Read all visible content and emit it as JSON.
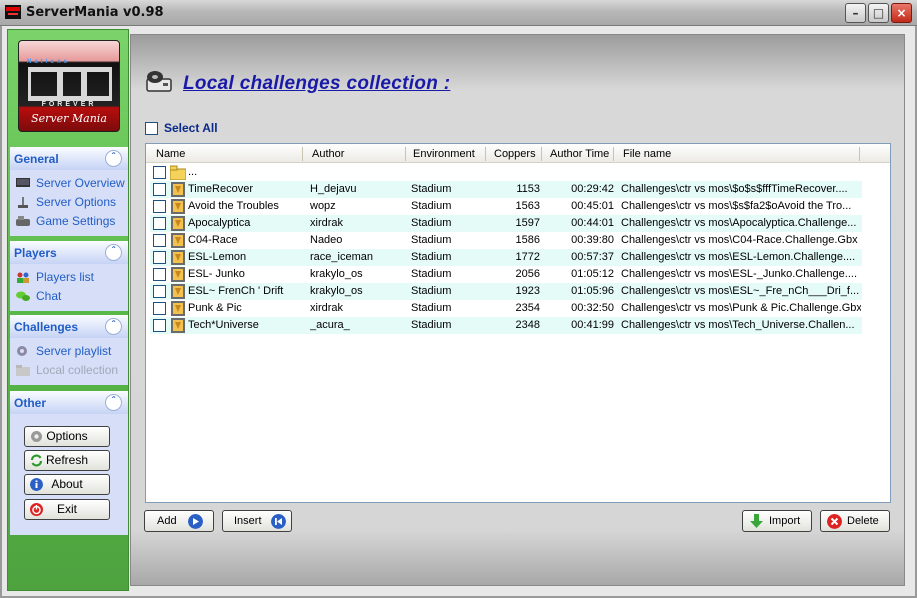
{
  "window": {
    "title": "ServerMania v0.98"
  },
  "logo": {
    "top_text": "Nations",
    "middle_text": "FOREVER",
    "bottom_text": "Server Mania"
  },
  "sidebar": {
    "groups": [
      {
        "title": "General",
        "items": [
          {
            "label": "Server Overview",
            "icon": "monitor-icon"
          },
          {
            "label": "Server Options",
            "icon": "joystick-icon"
          },
          {
            "label": "Game Settings",
            "icon": "gamepad-icon"
          }
        ]
      },
      {
        "title": "Players",
        "items": [
          {
            "label": "Players list",
            "icon": "users-icon"
          },
          {
            "label": "Chat",
            "icon": "chat-icon"
          }
        ]
      },
      {
        "title": "Challenges",
        "items": [
          {
            "label": "Server playlist",
            "icon": "playlist-icon"
          },
          {
            "label": "Local collection",
            "icon": "folder-icon",
            "disabled": true
          }
        ]
      },
      {
        "title": "Other",
        "items": []
      }
    ],
    "buttons": {
      "options": "Options",
      "refresh": "Refresh",
      "about": "About",
      "exit": "Exit"
    }
  },
  "main": {
    "heading": "Local challenges collection :",
    "select_all": "Select All",
    "columns": [
      "Name",
      "Author",
      "Environment",
      "Coppers",
      "Author Time",
      "File name"
    ],
    "parent_row": "...",
    "rows": [
      {
        "name": "TimeRecover",
        "author": "H_dejavu",
        "env": "Stadium",
        "coppers": "1153",
        "time": "00:29:42",
        "file": "Challenges\\ctr vs mos\\$o$s$fffTimeRecover...."
      },
      {
        "name": "Avoid the Troubles",
        "author": "wopz",
        "env": "Stadium",
        "coppers": "1563",
        "time": "00:45:01",
        "file": "Challenges\\ctr vs mos\\$s$fa2$oAvoid the Tro..."
      },
      {
        "name": "Apocalyptica",
        "author": "xirdrak",
        "env": "Stadium",
        "coppers": "1597",
        "time": "00:44:01",
        "file": "Challenges\\ctr vs mos\\Apocalyptica.Challenge..."
      },
      {
        "name": "C04-Race",
        "author": "Nadeo",
        "env": "Stadium",
        "coppers": "1586",
        "time": "00:39:80",
        "file": "Challenges\\ctr vs mos\\C04-Race.Challenge.Gbx"
      },
      {
        "name": "ESL-Lemon",
        "author": "race_iceman",
        "env": "Stadium",
        "coppers": "1772",
        "time": "00:57:37",
        "file": "Challenges\\ctr vs mos\\ESL-Lemon.Challenge...."
      },
      {
        "name": "ESL- Junko",
        "author": "krakylo_os",
        "env": "Stadium",
        "coppers": "2056",
        "time": "01:05:12",
        "file": "Challenges\\ctr vs mos\\ESL-_Junko.Challenge...."
      },
      {
        "name": "ESL~ FrenCh ' Drift",
        "author": "krakylo_os",
        "env": "Stadium",
        "coppers": "1923",
        "time": "01:05:96",
        "file": "Challenges\\ctr vs mos\\ESL~_Fre_nCh___Dri_f..."
      },
      {
        "name": "Punk & Pic",
        "author": "xirdrak",
        "env": "Stadium",
        "coppers": "2354",
        "time": "00:32:50",
        "file": "Challenges\\ctr vs mos\\Punk & Pic.Challenge.Gbx"
      },
      {
        "name": "Tech*Universe",
        "author": "_acura_",
        "env": "Stadium",
        "coppers": "2348",
        "time": "00:41:99",
        "file": "Challenges\\ctr vs mos\\Tech_Universe.Challen..."
      }
    ],
    "buttons": {
      "add": "Add",
      "insert": "Insert",
      "import": "Import",
      "delete": "Delete"
    }
  },
  "colors": {
    "sidebar_green": "#58b948",
    "nav_blue": "#215dc6",
    "row_alt": "#e5fbf8",
    "heading": "#1a1aa8"
  }
}
